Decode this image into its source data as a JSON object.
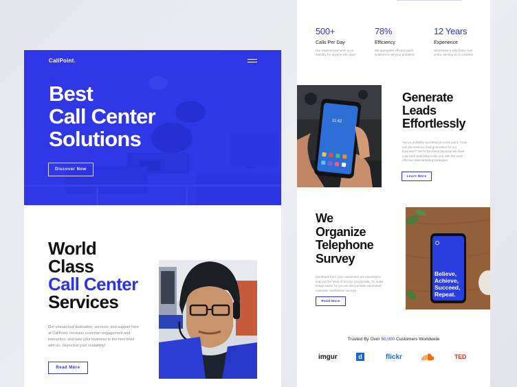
{
  "hero": {
    "brand": "CallPoint.",
    "title_lines": [
      "Best",
      "Call Center",
      "Solutions"
    ],
    "cta_label": "Discover Now"
  },
  "services": {
    "title_line1": "World",
    "title_line2": "Class",
    "title_accent": "Call Center",
    "title_line4": "Services",
    "body": "Get unmatched dedication, services, and support here at CallPoint. Increase customer engagement and interaction, and take your business to the next level with us. Skyrocket your scalability!",
    "cta_label": "Read More"
  },
  "stats": [
    {
      "value": "500+",
      "label": "Calls Per Day",
      "desc": "Our experienced team is on standby for anyone who says"
    },
    {
      "value": "78%",
      "label": "Efficiency",
      "desc": "We guarantee efficient quick solutions to all your problems"
    },
    {
      "value": "12 Years",
      "label": "Experience",
      "desc": "Developed a solid base over years, serving as a complete"
    }
  ],
  "leads": {
    "title_lines": [
      "Generate",
      "Leads",
      "Effortlessly"
    ],
    "body": "You've probably wondered at some point: \"How can we enhance lead generation for our business?\" We're the finest because we have your back and will provide you with the most effective telemarketing strategies.",
    "cta_label": "Learn More"
  },
  "survey": {
    "title_lines": [
      "We",
      "Organize",
      "Telephone",
      "Survey"
    ],
    "body": "Feedback from your consumers are essential to improve the level of service you provide. To make things easier for you we also provide automated customer satisfaction surveys.",
    "cta_label": "Read More"
  },
  "phone_home": {
    "time": "11:42"
  },
  "phone_screen": {
    "text_lines": [
      "Believe,",
      "Achieve,",
      "Succeed,",
      "Repeat."
    ]
  },
  "trusted": {
    "prefix": "Trusted By Over ",
    "count": "50,000",
    "suffix": " Customers Worldwide"
  },
  "logos": [
    {
      "name": "imgur",
      "color": "#111111"
    },
    {
      "name": "d",
      "color": "#ffffff",
      "bg": "#1b66cc"
    },
    {
      "name": "flickr",
      "color": "#1b66cc"
    },
    {
      "name": "soundcloud-icon",
      "color": "#ff6a00"
    },
    {
      "name": "TED",
      "color": "#e62b1e"
    }
  ],
  "colors": {
    "accent": "#2b33e5",
    "hero_bg": "#2f37e6"
  }
}
